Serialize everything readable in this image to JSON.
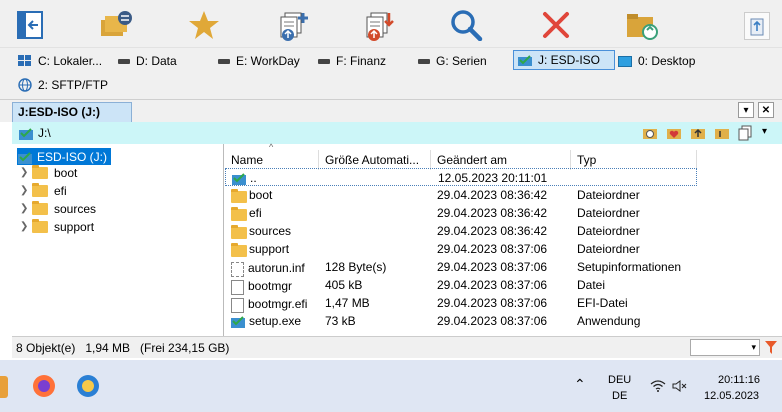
{
  "toolbar": {
    "buttons": [
      "panel-layout-icon",
      "folder-compare-icon",
      "favorites-star-icon",
      "copy-to-icon",
      "move-to-icon",
      "search-icon",
      "delete-icon",
      "sync-folder-icon",
      "recycle-bin-icon"
    ]
  },
  "drives": [
    {
      "label": "C: Lokaler..."
    },
    {
      "label": "D: Data"
    },
    {
      "label": "E: WorkDay"
    },
    {
      "label": "F: Finanz"
    },
    {
      "label": "G: Serien"
    },
    {
      "label": "J: ESD-ISO"
    },
    {
      "label": "0: Desktop"
    },
    {
      "label": "2: SFTP/FTP"
    }
  ],
  "tab": {
    "label": "J:ESD-ISO (J:)"
  },
  "path": {
    "value": "J:\\"
  },
  "tree": {
    "root": "ESD-ISO (J:)",
    "items": [
      "boot",
      "efi",
      "sources",
      "support"
    ]
  },
  "list": {
    "columns": [
      "Name",
      "Größe Automati...",
      "Geändert am",
      "Typ"
    ],
    "rows": [
      {
        "name": "..",
        "size": "",
        "date": "12.05.2023 20:11:01",
        "type": ""
      },
      {
        "name": "boot",
        "size": "",
        "date": "29.04.2023 08:36:42",
        "type": "Dateiordner"
      },
      {
        "name": "efi",
        "size": "",
        "date": "29.04.2023 08:36:42",
        "type": "Dateiordner"
      },
      {
        "name": "sources",
        "size": "",
        "date": "29.04.2023 08:36:42",
        "type": "Dateiordner"
      },
      {
        "name": "support",
        "size": "",
        "date": "29.04.2023 08:37:06",
        "type": "Dateiordner"
      },
      {
        "name": "autorun.inf",
        "size": "128 Byte(s)",
        "date": "29.04.2023 08:37:06",
        "type": "Setupinformationen"
      },
      {
        "name": "bootmgr",
        "size": "405 kB",
        "date": "29.04.2023 08:37:06",
        "type": "Datei"
      },
      {
        "name": "bootmgr.efi",
        "size": "1,47 MB",
        "date": "29.04.2023 08:37:06",
        "type": "EFI-Datei"
      },
      {
        "name": "setup.exe",
        "size": "73 kB",
        "date": "29.04.2023 08:37:06",
        "type": "Anwendung"
      }
    ]
  },
  "status": {
    "text": "8 Objekt(e)   1,94 MB   (Frei 234,15 GB)"
  },
  "taskbar": {
    "lang_top": "DEU",
    "lang_bottom": "DE",
    "time": "20:11:16",
    "date": "12.05.2023"
  },
  "colors": {
    "selection": "#0078d7",
    "path_bg": "#ccf6f8",
    "folder": "#f3c04a"
  }
}
